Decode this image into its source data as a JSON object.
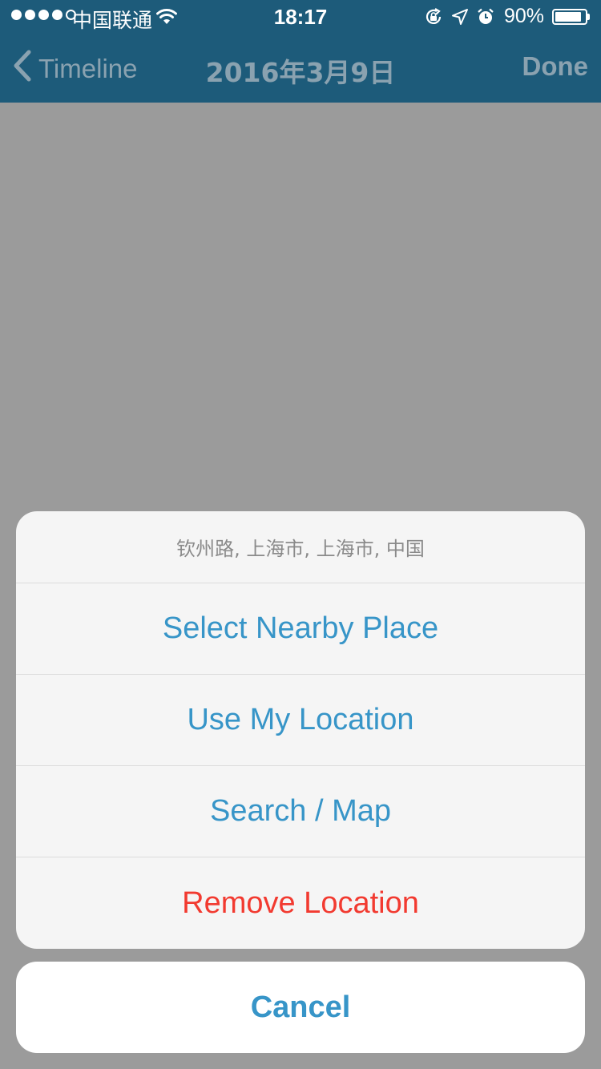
{
  "status_bar": {
    "carrier": "中国联通",
    "time": "18:17",
    "battery": "90%",
    "battery_level": 0.9,
    "signal_bars": 4,
    "signal_total": 5,
    "icons": [
      "wifi-icon",
      "rotation-lock-icon",
      "location-arrow-icon",
      "alarm-icon",
      "battery-icon"
    ]
  },
  "nav": {
    "back_label": "Timeline",
    "title": "2016年3月9日",
    "done_label": "Done"
  },
  "action_sheet": {
    "title": "钦州路, 上海市, 上海市, 中国",
    "actions": [
      {
        "label": "Select Nearby Place",
        "style": "default"
      },
      {
        "label": "Use My Location",
        "style": "default"
      },
      {
        "label": "Search / Map",
        "style": "default"
      },
      {
        "label": "Remove Location",
        "style": "destructive"
      }
    ],
    "cancel_label": "Cancel"
  },
  "colors": {
    "dim_background": "#9b9b9b",
    "bar_dimmed": "#1d5b7a",
    "action_blue": "#3795c8",
    "destructive_red": "#f23a30"
  }
}
